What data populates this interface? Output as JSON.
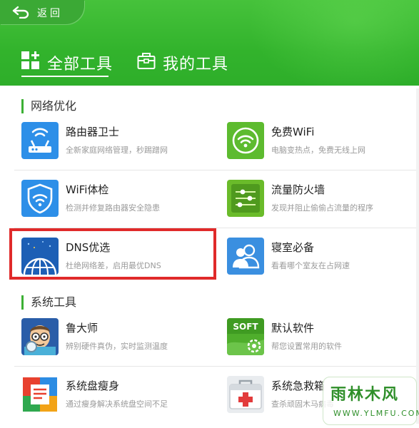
{
  "header": {
    "back_label": "返回",
    "tabs": [
      {
        "label": "全部工具",
        "icon": "grid-plus-icon",
        "active": true
      },
      {
        "label": "我的工具",
        "icon": "toolbox-icon",
        "active": false
      }
    ]
  },
  "sections": [
    {
      "title": "网络优化",
      "tools": [
        {
          "name": "路由器卫士",
          "desc": "全新家庭网络管理，秒踢蹭网",
          "icon": "router-icon",
          "color": "#2d8fe8"
        },
        {
          "name": "免费WiFi",
          "desc": "电脑变热点，免费无线上网",
          "icon": "wifi-icon",
          "color": "#5dbb2f"
        },
        {
          "name": "WiFi体检",
          "desc": "检测并修复路由器安全隐患",
          "icon": "wifi-shield-icon",
          "color": "#2d8fe8"
        },
        {
          "name": "流量防火墙",
          "desc": "发现并阻止偷偷占流量的程序",
          "icon": "traffic-icon",
          "color": "#6abb2a"
        },
        {
          "name": "DNS优选",
          "desc": "杜绝网络差，启用最优DNS",
          "icon": "globe-icon",
          "color": "#1d5fb5"
        },
        {
          "name": "寝室必备",
          "desc": "看看哪个室友在占网速",
          "icon": "roommates-icon",
          "color": "#3a8fe0"
        }
      ]
    },
    {
      "title": "系统工具",
      "tools": [
        {
          "name": "鲁大师",
          "desc": "辨别硬件真伪，实时监测温度",
          "icon": "master-lu-icon",
          "color": "#2a5da8"
        },
        {
          "name": "默认软件",
          "desc": "帮您设置常用的软件",
          "icon": "soft-icon",
          "color": "#4fae2c"
        },
        {
          "name": "系统盘瘦身",
          "desc": "通过瘦身解决系统盘空间不足",
          "icon": "slim-icon",
          "color": "#f2a317"
        },
        {
          "name": "系统急救箱",
          "desc": "查杀顽固木马病毒",
          "icon": "first-aid-icon",
          "color": "#e23b3b"
        }
      ]
    }
  ],
  "watermark": {
    "main": "雨林木风",
    "sub": "WWW.YLMFU.COM"
  }
}
